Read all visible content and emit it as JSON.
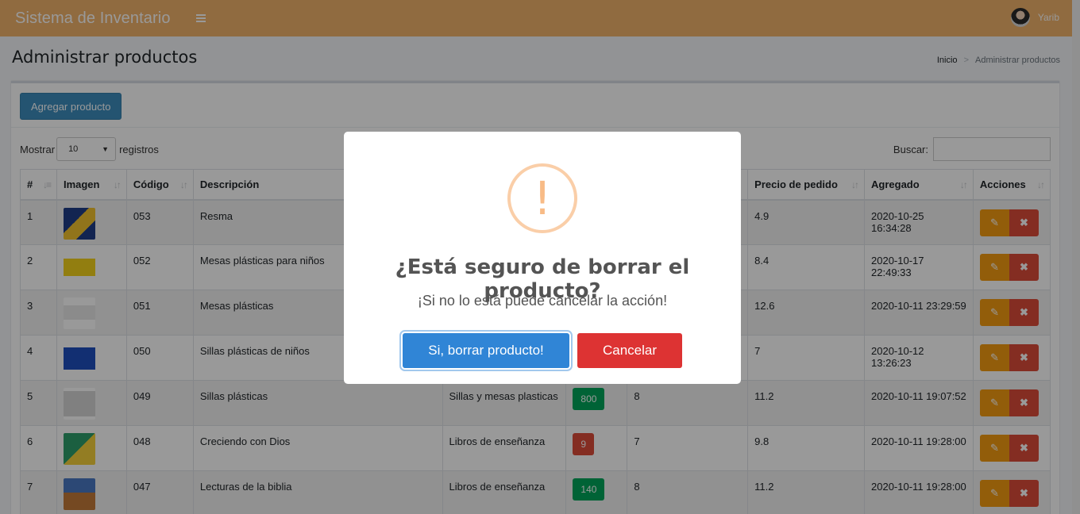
{
  "app": {
    "title": "Sistema de Inventario",
    "user": "Yarib"
  },
  "header": {
    "page_title": "Administrar productos",
    "breadcrumb_home": "Inicio",
    "breadcrumb_sep": ">",
    "breadcrumb_current": "Administrar productos"
  },
  "toolbar": {
    "add_label": "Agregar producto"
  },
  "controls": {
    "show_label": "Mostrar",
    "show_value": "10",
    "records_label": "registros",
    "search_label": "Buscar:"
  },
  "table": {
    "columns": [
      "#",
      "Imagen",
      "Código",
      "Descripción",
      "",
      "",
      "",
      "Precio de pedido",
      "Agregado",
      "Acciones"
    ],
    "rows": [
      {
        "n": "1",
        "code": "053",
        "desc": "Resma",
        "cat": "",
        "stock": "",
        "stock_color": "",
        "buy": "",
        "price": "4.9",
        "date": "2020-10-25 16:34:28"
      },
      {
        "n": "2",
        "code": "052",
        "desc": "Mesas plásticas para niños",
        "cat": "",
        "stock": "",
        "stock_color": "",
        "buy": "",
        "price": "8.4",
        "date": "2020-10-17 22:49:33"
      },
      {
        "n": "3",
        "code": "051",
        "desc": "Mesas plásticas",
        "cat": "",
        "stock": "",
        "stock_color": "",
        "buy": "",
        "price": "12.6",
        "date": "2020-10-11 23:29:59"
      },
      {
        "n": "4",
        "code": "050",
        "desc": "Sillas plásticas de niños",
        "cat": "",
        "stock": "",
        "stock_color": "",
        "buy": "",
        "price": "7",
        "date": "2020-10-12 13:26:23"
      },
      {
        "n": "5",
        "code": "049",
        "desc": "Sillas plásticas",
        "cat": "Sillas y mesas plasticas",
        "stock": "800",
        "stock_color": "green",
        "buy": "8",
        "price": "11.2",
        "date": "2020-10-11 19:07:52"
      },
      {
        "n": "6",
        "code": "048",
        "desc": "Creciendo con Dios",
        "cat": "Libros de enseñanza",
        "stock": "9",
        "stock_color": "red",
        "buy": "7",
        "price": "9.8",
        "date": "2020-10-11 19:28:00"
      },
      {
        "n": "7",
        "code": "047",
        "desc": "Lecturas de la biblia",
        "cat": "Libros de enseñanza",
        "stock": "140",
        "stock_color": "green",
        "buy": "8",
        "price": "11.2",
        "date": "2020-10-11 19:28:00"
      }
    ]
  },
  "modal": {
    "icon": "warning-icon",
    "icon_glyph": "!",
    "title": "¿Está seguro de borrar el producto?",
    "text": "¡Si no lo está puede cancelar la acción!",
    "confirm_label": "Si, borrar producto!",
    "cancel_label": "Cancelar"
  },
  "colors": {
    "navbar": "#f0b26b",
    "primary": "#3c8dbc",
    "confirm": "#3085d6",
    "cancel": "#dd3333",
    "edit": "#f39c12",
    "delete": "#dd4b39",
    "stock_green": "#00a65a",
    "stock_red": "#dd4b39"
  }
}
